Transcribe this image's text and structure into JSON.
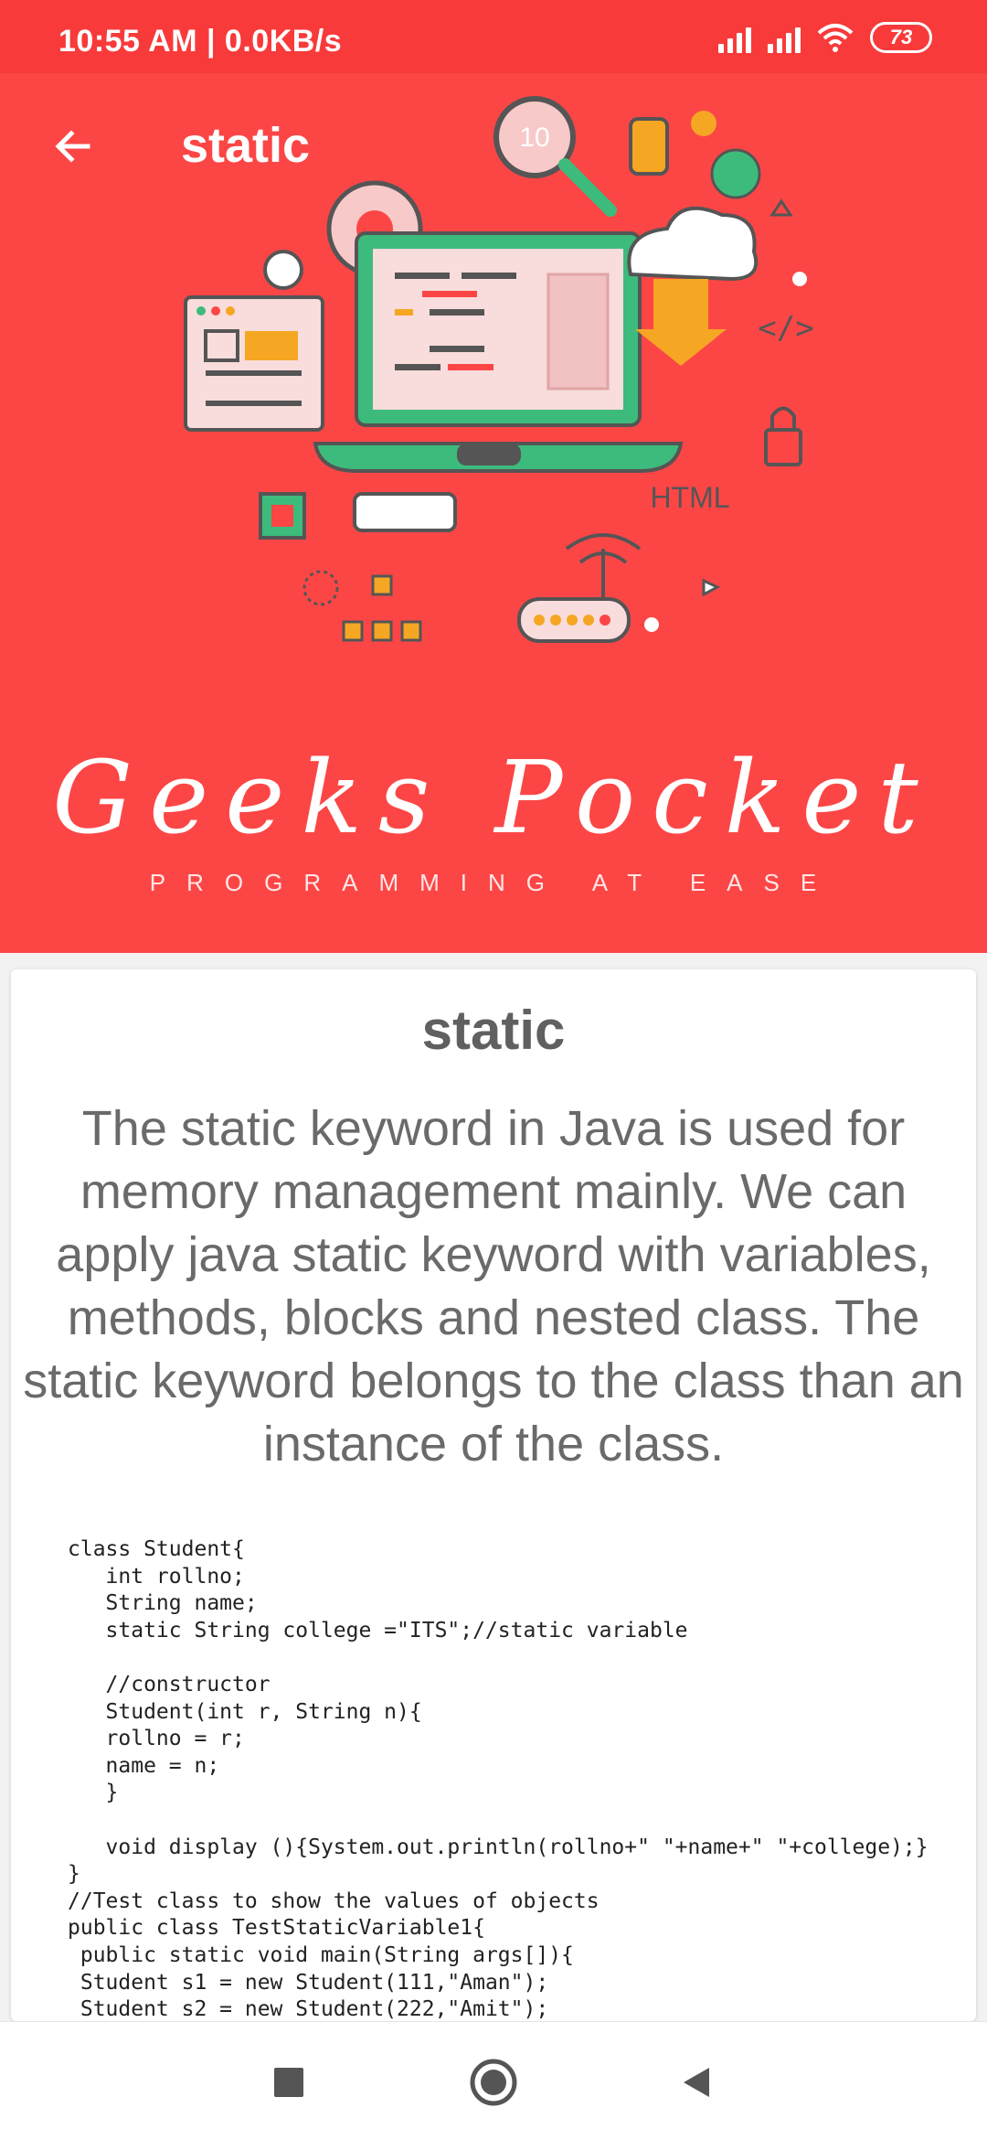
{
  "status_bar": {
    "time": "10:55 AM | 0.0KB/s",
    "battery": "73"
  },
  "toolbar": {
    "title": "static"
  },
  "banner": {
    "illustration_html_label": "HTML",
    "illustration_code_tag": "</>",
    "illustration_counter": "10",
    "brand_name": "Geeks Pocket",
    "tagline": "PROGRAMMING AT EASE"
  },
  "content": {
    "title": "static",
    "description": "The static keyword in Java is used for memory management mainly. We can apply java static keyword with variables, methods, blocks and nested class. The static keyword belongs to the class than an instance of the class.",
    "code": "class Student{\n   int rollno;\n   String name;\n   static String college =\"ITS\";//static variable\n\n   //constructor\n   Student(int r, String n){\n   rollno = r;\n   name = n;\n   }\n\n   void display (){System.out.println(rollno+\" \"+name+\" \"+college);}\n}\n//Test class to show the values of objects\npublic class TestStaticVariable1{\n public static void main(String args[]){\n Student s1 = new Student(111,\"Aman\");\n Student s2 = new Student(222,\"Amit\");"
  },
  "colors": {
    "accent": "#fc4646",
    "status_bar": "#f83a3a",
    "laptop_green": "#3dbb7c",
    "illustration_yellow": "#f5a623"
  }
}
